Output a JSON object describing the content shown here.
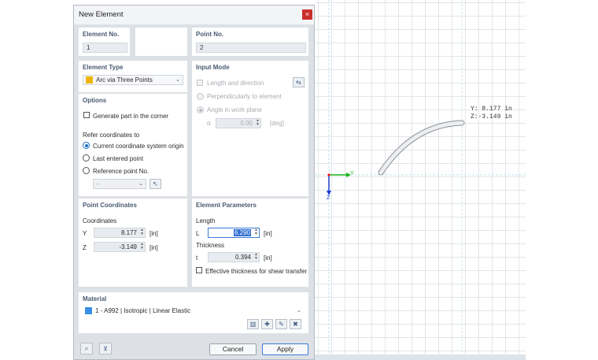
{
  "dialog": {
    "title": "New Element",
    "close_icon": "×",
    "element_no": {
      "label": "Element No.",
      "value": "1"
    },
    "point_no": {
      "label": "Point No.",
      "value": "2"
    },
    "element_type": {
      "label": "Element Type",
      "value": "Arc via Three Points",
      "color": "#f0b400"
    },
    "input_mode": {
      "label": "Input Mode",
      "length_direction": "Length and direction",
      "perpendicular": "Perpendicularly to element",
      "angle_plane": "Angle in work plane",
      "alpha_symbol": "α",
      "alpha_value": "0.00",
      "alpha_unit": "[deg]"
    },
    "options": {
      "label": "Options",
      "generate_corner": "Generate part in the corner",
      "refer_label": "Refer coordinates to",
      "refer_options": [
        "Current coordinate system origin",
        "Last entered point",
        "Reference point No."
      ],
      "reference_point_value": "--"
    },
    "point_coordinates": {
      "label": "Point Coordinates",
      "coords_label": "Coordinates",
      "y_label": "Y",
      "y_value": "8.177",
      "y_unit": "[in]",
      "z_label": "Z",
      "z_value": "-3.149",
      "z_unit": "[in]"
    },
    "element_parameters": {
      "label": "Element Parameters",
      "length_label": "Length",
      "l_label": "L",
      "l_value": "6.290",
      "l_unit": "[in]",
      "thickness_label": "Thickness",
      "t_label": "t",
      "t_value": "0.394",
      "t_unit": "[in]",
      "effective_thickness": "Effective thickness for shear transfer"
    },
    "material": {
      "label": "Material",
      "value": "1 - A992 | Isotropic | Linear Elastic",
      "color": "#3a8ee6"
    },
    "buttons": {
      "cancel": "Cancel",
      "apply": "Apply"
    }
  },
  "canvas": {
    "readout_y": "Y:  8.177 in",
    "readout_z": "Z:-3.149 in",
    "axis_y": "Y",
    "axis_z": "Z"
  }
}
